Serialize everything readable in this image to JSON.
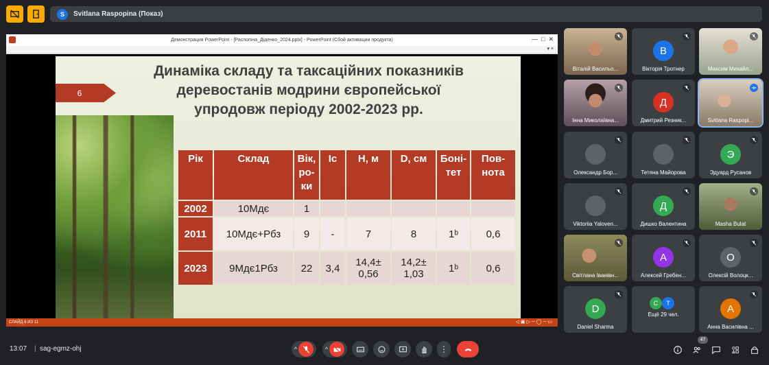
{
  "presenter": {
    "avatar_letter": "S",
    "label": "Svitlana Raspopina (Показ)"
  },
  "ppt": {
    "window_title": "Демонстрация PowerPoint - [Распопіна_Діденко_2024.pptx] - PowerPoint (Сбой активации продукта)",
    "status": "СЛАЙД 6 ИЗ 11"
  },
  "slide": {
    "number": "6",
    "title_lines": [
      "Динаміка складу та таксаційних показників",
      "деревостанів модрини європейської",
      "упродовж періоду 2002-2023 рр."
    ],
    "headers": [
      "Рік",
      "Склад",
      "Вік, ро- ки",
      "Іс",
      "Н, м",
      "D, см",
      "Боні- тет",
      "Пов- нота"
    ],
    "rows": [
      [
        "2002",
        "10Мдє",
        "1",
        "",
        "",
        "",
        "",
        ""
      ],
      [
        "2011",
        "10Мдє+Рбз",
        "9",
        "-",
        "7",
        "8",
        "1ᵇ",
        "0,6"
      ],
      [
        "2023",
        "9Мдє1Рбз",
        "22",
        "3,4",
        "14,4± 0,56",
        "14,2± 1,03",
        "1ᵇ",
        "0,6"
      ]
    ]
  },
  "participants": [
    {
      "name": "Віталій Васильо...",
      "letter": "",
      "color": "",
      "photo": true
    },
    {
      "name": "Вікторія Тротнер",
      "letter": "В",
      "color": "#1a73e8",
      "photo": false
    },
    {
      "name": "Максим Михайл...",
      "letter": "",
      "color": "",
      "photo": true
    },
    {
      "name": "Інна Миколаївна...",
      "letter": "",
      "color": "",
      "photo": true
    },
    {
      "name": "Дмитрий Резник...",
      "letter": "Д",
      "color": "#d93025",
      "photo": false
    },
    {
      "name": "Svitlana Raspopi...",
      "letter": "",
      "color": "",
      "photo": true
    },
    {
      "name": "Олександр Бор...",
      "letter": "",
      "color": "#5f6368",
      "photo": false
    },
    {
      "name": "Тетяна Майорова",
      "letter": "",
      "color": "#5f6368",
      "photo": false
    },
    {
      "name": "Эдуард Русанов",
      "letter": "Э",
      "color": "#34a853",
      "photo": false
    },
    {
      "name": "Viktoriia Yaloven...",
      "letter": "",
      "color": "#5f6368",
      "photo": false
    },
    {
      "name": "Дишко Валентина",
      "letter": "Д",
      "color": "#34a853",
      "photo": false
    },
    {
      "name": "Masha Bulat",
      "letter": "",
      "color": "",
      "photo": true
    },
    {
      "name": "Світлана Іванівн...",
      "letter": "",
      "color": "",
      "photo": true
    },
    {
      "name": "Алексей Гребен...",
      "letter": "А",
      "color": "#9334e6",
      "photo": false
    },
    {
      "name": "Олексій Волоцк...",
      "letter": "О",
      "color": "#5f6368",
      "photo": false
    },
    {
      "name": "Daniel Sharma",
      "letter": "D",
      "color": "#34a853",
      "photo": false
    },
    {
      "name": "Ещё 29 чел.",
      "letter": "",
      "color": "",
      "photo": false
    },
    {
      "name": "Анна Василівна ...",
      "letter": "А",
      "color": "#e37400",
      "photo": false
    }
  ],
  "more": {
    "a": "С",
    "b": "Т"
  },
  "bottom": {
    "time": "13:07",
    "meeting_code": "sag-egmz-ohj",
    "people_count": "47"
  },
  "colors": {
    "accent": "#f9ab00",
    "end_call": "#ea4335",
    "slide_red": "#b33a25"
  }
}
